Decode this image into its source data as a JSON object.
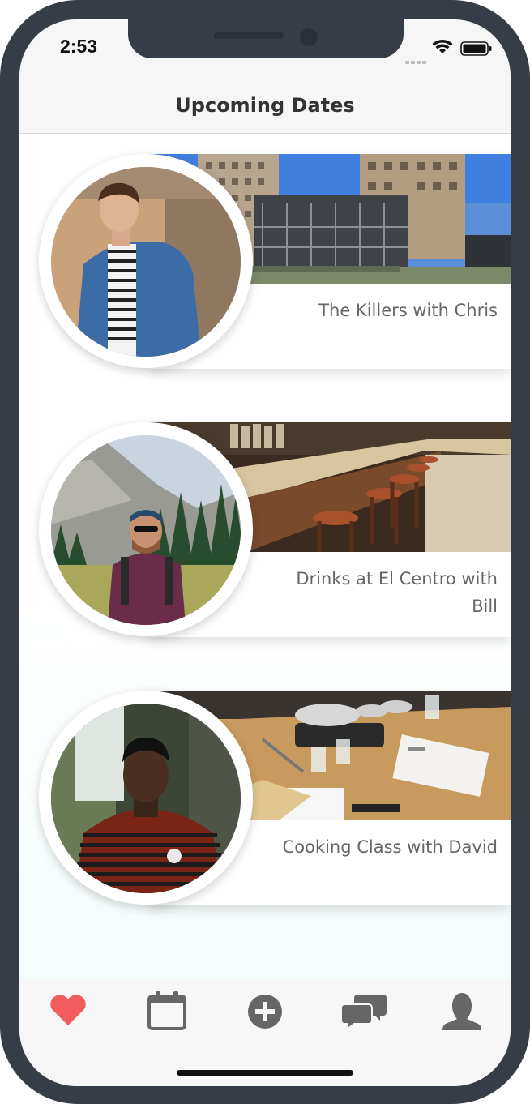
{
  "status_bar": {
    "time": "2:53"
  },
  "header": {
    "title": "Upcoming Dates"
  },
  "dates": [
    {
      "title": "The Killers with Chris"
    },
    {
      "title": "Drinks at El Centro with Bill"
    },
    {
      "title": "Cooking Class with David"
    }
  ],
  "tab_bar": {
    "items": [
      {
        "icon": "heart-icon",
        "active": true
      },
      {
        "icon": "calendar-icon",
        "active": false
      },
      {
        "icon": "plus-circle-icon",
        "active": false
      },
      {
        "icon": "chat-bubbles-icon",
        "active": false
      },
      {
        "icon": "person-icon",
        "active": false
      }
    ]
  },
  "colors": {
    "accent": "#f25b5b",
    "icon_inactive": "#666666",
    "device_frame": "#363d47"
  }
}
